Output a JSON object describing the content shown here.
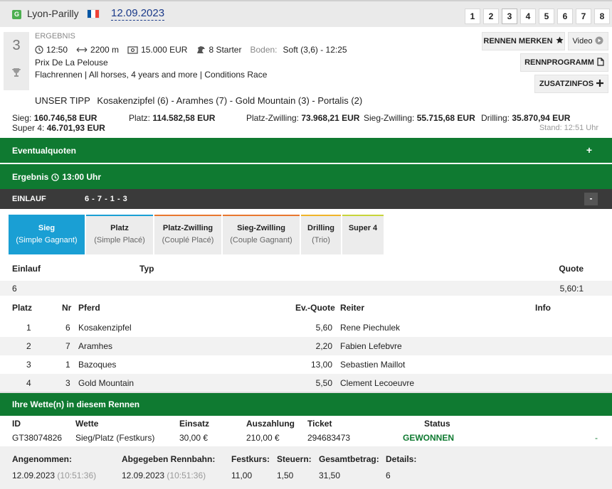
{
  "header": {
    "badge": "G",
    "track": "Lyon-Parilly",
    "date": "12.09.2023",
    "race_numbers": [
      "1",
      "2",
      "3",
      "4",
      "5",
      "6",
      "7",
      "8"
    ],
    "active_race": "3",
    "flag_colors": [
      "#0055a4",
      "#ffffff",
      "#ef4135"
    ]
  },
  "race": {
    "number": "3",
    "status_label": "ERGEBNIS",
    "time": "12:50",
    "distance": "2200 m",
    "prize": "15.000 EUR",
    "starters": "8 Starter",
    "ground_label": "Boden:",
    "ground": "Soft (3,6) - 12:25",
    "name": "Prix De La Pelouse",
    "conditions": "Flachrennen | All horses, 4 years and more | Conditions Race",
    "tipp_label": "UNSER TIPP",
    "tipp": "Kosakenzipfel (6) - Aramhes (7) - Gold Mountain (3) - Portalis (2)"
  },
  "buttons": {
    "merken": "RENNEN MERKEN",
    "video": "Video",
    "programm": "RENNPROGRAMM",
    "zusatz": "ZUSATZINFOS"
  },
  "payouts": {
    "sieg_label": "Sieg:",
    "sieg": "160.746,58 EUR",
    "platz_label": "Platz:",
    "platz": "114.582,58 EUR",
    "pz_label": "Platz-Zwilling:",
    "pz": "73.968,21 EUR",
    "sz_label": "Sieg-Zwilling:",
    "sz": "55.715,68 EUR",
    "drilling_label": "Drilling:",
    "drilling": "35.870,94 EUR",
    "super4_label": "Super 4:",
    "super4": "46.701,93 EUR",
    "stand": "Stand: 12:51 Uhr"
  },
  "eventual": {
    "title": "Eventualquoten",
    "toggle": "+"
  },
  "result": {
    "title_prefix": "Ergebnis",
    "title_time": "13:00 Uhr"
  },
  "einlauf_bar": {
    "label": "EINLAUF",
    "value": "6 - 7 - 1 - 3",
    "toggle": "-"
  },
  "tabs": [
    {
      "a": "Sieg",
      "b": "(Simple Gagnant)",
      "accent": "#1a9fd4",
      "active": true
    },
    {
      "a": "Platz",
      "b": "(Simple Placé)",
      "accent": "#1a9fd4",
      "active": false
    },
    {
      "a": "Platz-Zwilling",
      "b": "(Couplé Placé)",
      "accent": "#e8772e",
      "active": false
    },
    {
      "a": "Sieg-Zwilling",
      "b": "(Couple Gagnant)",
      "accent": "#e8772e",
      "active": false
    },
    {
      "a": "Drilling",
      "b": "(Trio)",
      "accent": "#f0b429",
      "active": false
    },
    {
      "a": "Super 4",
      "b": "",
      "accent": "#c8d43a",
      "active": false
    }
  ],
  "quote_table": {
    "headers": {
      "einlauf": "Einlauf",
      "typ": "Typ",
      "quote": "Quote"
    },
    "row": {
      "einlauf": "6",
      "typ": "",
      "quote": "5,60:1"
    }
  },
  "placings": {
    "headers": {
      "platz": "Platz",
      "nr": "Nr",
      "pferd": "Pferd",
      "quote": "Ev.-Quote",
      "reiter": "Reiter",
      "info": "Info"
    },
    "rows": [
      {
        "platz": "1",
        "nr": "6",
        "pferd": "Kosakenzipfel",
        "quote": "5,60",
        "reiter": "Rene Piechulek"
      },
      {
        "platz": "2",
        "nr": "7",
        "pferd": "Aramhes",
        "quote": "2,20",
        "reiter": "Fabien Lefebvre"
      },
      {
        "platz": "3",
        "nr": "1",
        "pferd": "Bazoques",
        "quote": "13,00",
        "reiter": "Sebastien Maillot"
      },
      {
        "platz": "4",
        "nr": "3",
        "pferd": "Gold Mountain",
        "quote": "5,50",
        "reiter": "Clement Lecoeuvre"
      }
    ]
  },
  "bets": {
    "title": "Ihre Wette(n) in diesem Rennen",
    "headers": {
      "id": "ID",
      "wette": "Wette",
      "einsatz": "Einsatz",
      "auszahlung": "Auszahlung",
      "ticket": "Ticket",
      "status": "Status"
    },
    "row": {
      "id": "GT38074826",
      "wette": "Sieg/Platz (Festkurs)",
      "einsatz": "30,00 €",
      "auszahlung": "210,00 €",
      "ticket": "294683473",
      "status": "GEWONNEN",
      "extra": "-"
    }
  },
  "summary": {
    "angenommen_label": "Angenommen:",
    "angenommen_date": "12.09.2023",
    "angenommen_time": "(10:51:36)",
    "abgegeben_label": "Abgegeben Rennbahn:",
    "abgegeben_date": "12.09.2023",
    "abgegeben_time": "(10:51:36)",
    "festkurs_label": "Festkurs:",
    "festkurs": "11,00",
    "steuern_label": "Steuern:",
    "steuern": "1,50",
    "gesamt_label": "Gesamtbetrag:",
    "gesamt": "31,50",
    "details_label": "Details:",
    "details": "6"
  }
}
